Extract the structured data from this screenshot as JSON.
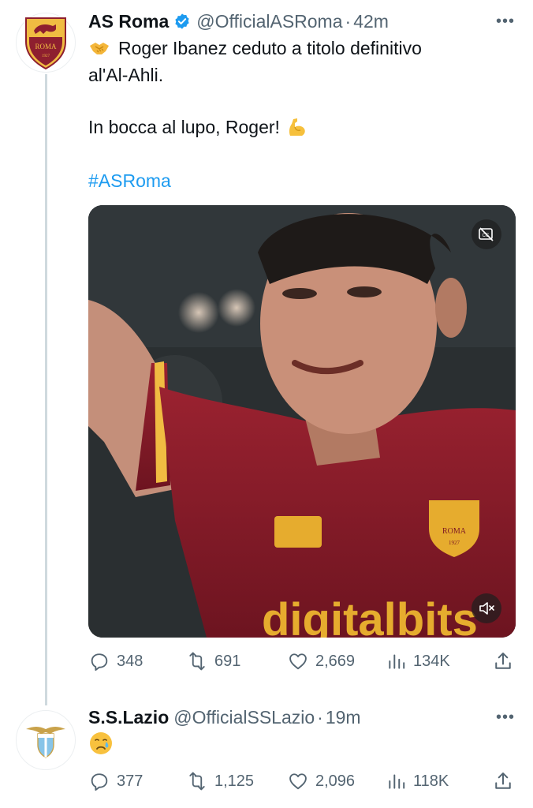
{
  "tweets": [
    {
      "display_name": "AS Roma",
      "handle": "@OfficialASRoma",
      "separator": "·",
      "time": "42m",
      "avatar_text": "ROMA",
      "text_line1": "Roger Ibanez ceduto a titolo definitivo",
      "text_line2": "al'Al-Ahli.",
      "text_line3": "In bocca al lupo, Roger!",
      "hashtag": "#ASRoma",
      "media": {
        "crest_text": "ROMA",
        "crest_year": "1927",
        "sponsor_text": "digitalbits"
      },
      "stats": {
        "replies": "348",
        "reposts": "691",
        "likes": "2,669",
        "views": "134K"
      }
    },
    {
      "display_name": "S.S.Lazio",
      "handle": "@OfficialSSLazio",
      "separator": "·",
      "time": "19m",
      "stats": {
        "replies": "377",
        "reposts": "1,125",
        "likes": "2,096",
        "views": "118K"
      }
    }
  ],
  "icons": {
    "verified": "verified-badge-icon",
    "more": "more-icon",
    "reply": "reply-icon",
    "repost": "repost-icon",
    "like": "like-icon",
    "views": "views-icon",
    "share": "share-icon",
    "captions": "captions-icon",
    "mute": "mute-icon"
  },
  "colors": {
    "accent": "#1d9bf0",
    "muted": "#536471",
    "roma_red": "#8e1f2f",
    "roma_gold": "#f0bc42",
    "lazio_blue": "#87c4e8"
  }
}
